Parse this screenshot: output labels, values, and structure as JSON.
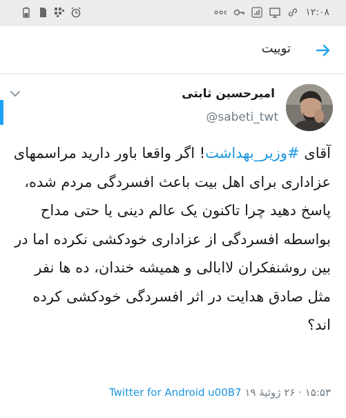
{
  "status_bar": {
    "time": "۱۲:۰۸",
    "left_icons": [
      "battery-icon",
      "sim-icon",
      "grid-icon",
      "alarm-icon"
    ],
    "right_icons": [
      "more-dots-icon",
      "key-icon",
      "signal-icon",
      "cast-icon",
      "link-icon"
    ]
  },
  "header": {
    "title": "توییت",
    "back_icon": "arrow-right-icon"
  },
  "tweet": {
    "display_name": "امیرحسین ثابتی",
    "handle": "@sabeti_twt",
    "text_before": "آقای ",
    "hashtag": "#وزیر_بهداشت",
    "text_after": "! اگر واقعا باور دارید مراسمهای عزاداری برای اهل بیت باعث افسردگی مردم شده، پاسخ دهید چرا تاکنون یک عالم دینی یا حتی مداح بواسطه افسردگی از عزاداری خودکشی نکرده اما در بین روشنفکران لاابالی و همیشه خندان، ده ها نفر مثل صادق هدایت در اثر افسردگی خودکشی کرده اند؟",
    "time_date": "۱۵:۵۳ · ۲۶ ژوئیهٔ ۱۹",
    "source": "Twitter for Android u00B7"
  },
  "colors": {
    "accent": "#1da1f2",
    "link": "#1b95e0",
    "muted": "#6d7b86"
  }
}
